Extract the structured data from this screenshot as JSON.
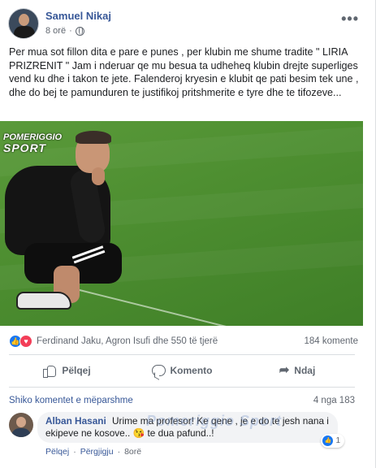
{
  "post": {
    "author": "Samuel Nikaj",
    "time": "8 orë",
    "privacy_icon": "globe-icon",
    "more_icon": "more-options-icon",
    "more_symbol": "•••",
    "text": "Per mua sot fillon dita e pare e punes , per klubin me shume tradite \" LIRIA PRIZRENIT \" Jam i nderuar qe mu besua ta udheheq klubin drejte superliges vend ku dhe i takon te jete. Falenderoj kryesin e klubit qe pati besim tek une , dhe do bej te pamunduren te justifikoj pritshmerite e tyre dhe te tifozeve...",
    "image_watermark_line1": "POMERIGGIO",
    "image_watermark_line2": "SPORT"
  },
  "reactions": {
    "names": "Ferdinand Jaku, Agron Isufi dhe 550 të tjerë",
    "comment_count": "184 komente",
    "like_symbol": "👍",
    "love_symbol": "♥"
  },
  "actions": {
    "like": "Pëlqej",
    "comment": "Komento",
    "share": "Ndaj",
    "share_symbol": "➦"
  },
  "comments": {
    "view_previous": "Shiko komentet e mëparshme",
    "pager": "4 nga 183",
    "items": [
      {
        "name": "Alban Hasani",
        "text": "Urime ma profesor! Ke qene , je e do te jesh nana i ekipeve ne kosove.. 😘 te dua pafund..!",
        "watermark": "Pomeriggio Sport",
        "reaction_count": "1",
        "like": "Pëlqej",
        "reply": "Përgjigju",
        "time": "8orë",
        "separator": "·"
      }
    ]
  },
  "colors": {
    "accent": "#385898",
    "like_blue": "#1877f2",
    "love_red": "#f33e58",
    "muted": "#616770"
  }
}
